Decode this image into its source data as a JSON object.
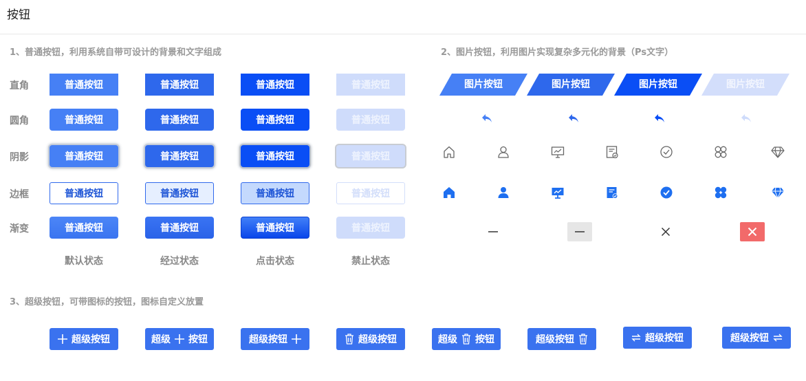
{
  "page_title": "按钮",
  "section1": {
    "title": "1、普通按钮，利用系统自带可设计的背景和文字组成",
    "button_label": "普通按钮",
    "rows": [
      "直角",
      "圆角",
      "阴影",
      "边框",
      "渐变"
    ],
    "states": [
      "默认状态",
      "经过状态",
      "点击状态",
      "禁止状态"
    ]
  },
  "section2": {
    "title": "2、图片按钮，利用图片实现复杂多元化的背景（Ps文字）",
    "button_label": "图片按钮",
    "outline_icons": [
      "home-outline-icon",
      "user-outline-icon",
      "monitor-chart-outline-icon",
      "document-check-outline-icon",
      "check-circle-outline-icon",
      "clover-outline-icon",
      "diamond-outline-icon"
    ],
    "filled_icons": [
      "home-filled-icon",
      "user-filled-icon",
      "monitor-chart-filled-icon",
      "document-check-filled-icon",
      "check-circle-filled-icon",
      "clover-filled-icon",
      "diamond-filled-icon"
    ]
  },
  "section3": {
    "title": "3、超级按钮，可带图标的按钮，图标自定义放置",
    "label_full": "超级按钮",
    "label_left": "超级",
    "label_right": "按钮"
  },
  "colors": {
    "default": "#4680f5",
    "hover": "#2e68ec",
    "active": "#0a4ef5",
    "disabled": "#cfdcfb",
    "close_hover": "#f26a6a"
  }
}
